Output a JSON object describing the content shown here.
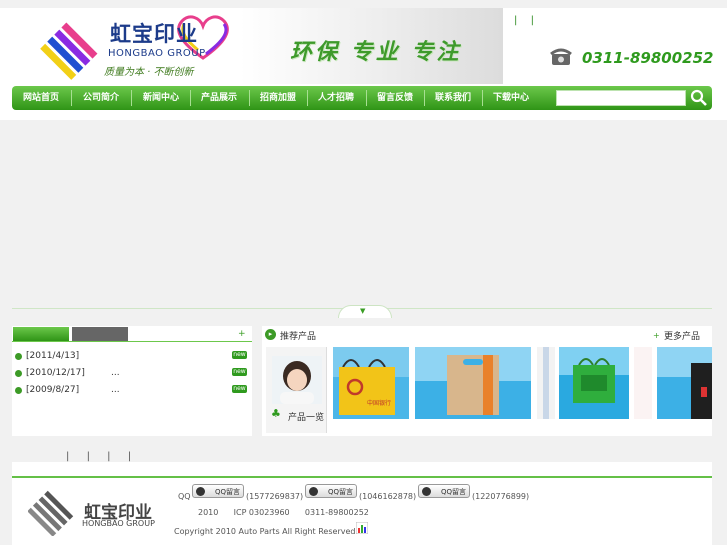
{
  "header": {
    "logo_cn": "虹宝印业",
    "logo_en": "HONGBAO GROUP",
    "logo_slogan": "质量为本 · 不断创新",
    "slogan": "环保 专业 专注",
    "phone": "0311-89800252",
    "top_links": [
      "|",
      "|"
    ]
  },
  "nav": {
    "items": [
      "网站首页",
      "公司简介",
      "新闻中心",
      "产品展示",
      "招商加盟",
      "人才招聘",
      "留言反馈",
      "联系我们",
      "下载中心"
    ],
    "search_placeholder": ""
  },
  "news": {
    "more": "+",
    "items": [
      {
        "date": "[2011/4/13]",
        "suffix": "",
        "badge": "new"
      },
      {
        "date": "[2010/12/17]",
        "suffix": "...",
        "badge": "new"
      },
      {
        "date": "[2009/8/27]",
        "suffix": "...",
        "badge": "new"
      }
    ]
  },
  "products": {
    "title": "推荐产品",
    "more": "更多产品",
    "all_label": "产品一览",
    "bag_print": "中国银行"
  },
  "footer": {
    "links": [
      "|",
      "|",
      "|",
      "|"
    ],
    "logo_cn": "虹宝印业",
    "logo_en": "HONGBAO GROUP",
    "qq_label": "QQ",
    "qq_button_label": "QQ留言",
    "qq_numbers": [
      "(1577269837)",
      "(1046162878)",
      "(1220776899)"
    ],
    "line2": "2010      ICP 03023960      0311-89800252",
    "copyright": "Copyright 2010 Auto Parts All Right Reserved"
  },
  "colors": {
    "brand_green": "#2f9a1e",
    "brand_blue": "#1c3b8a"
  }
}
